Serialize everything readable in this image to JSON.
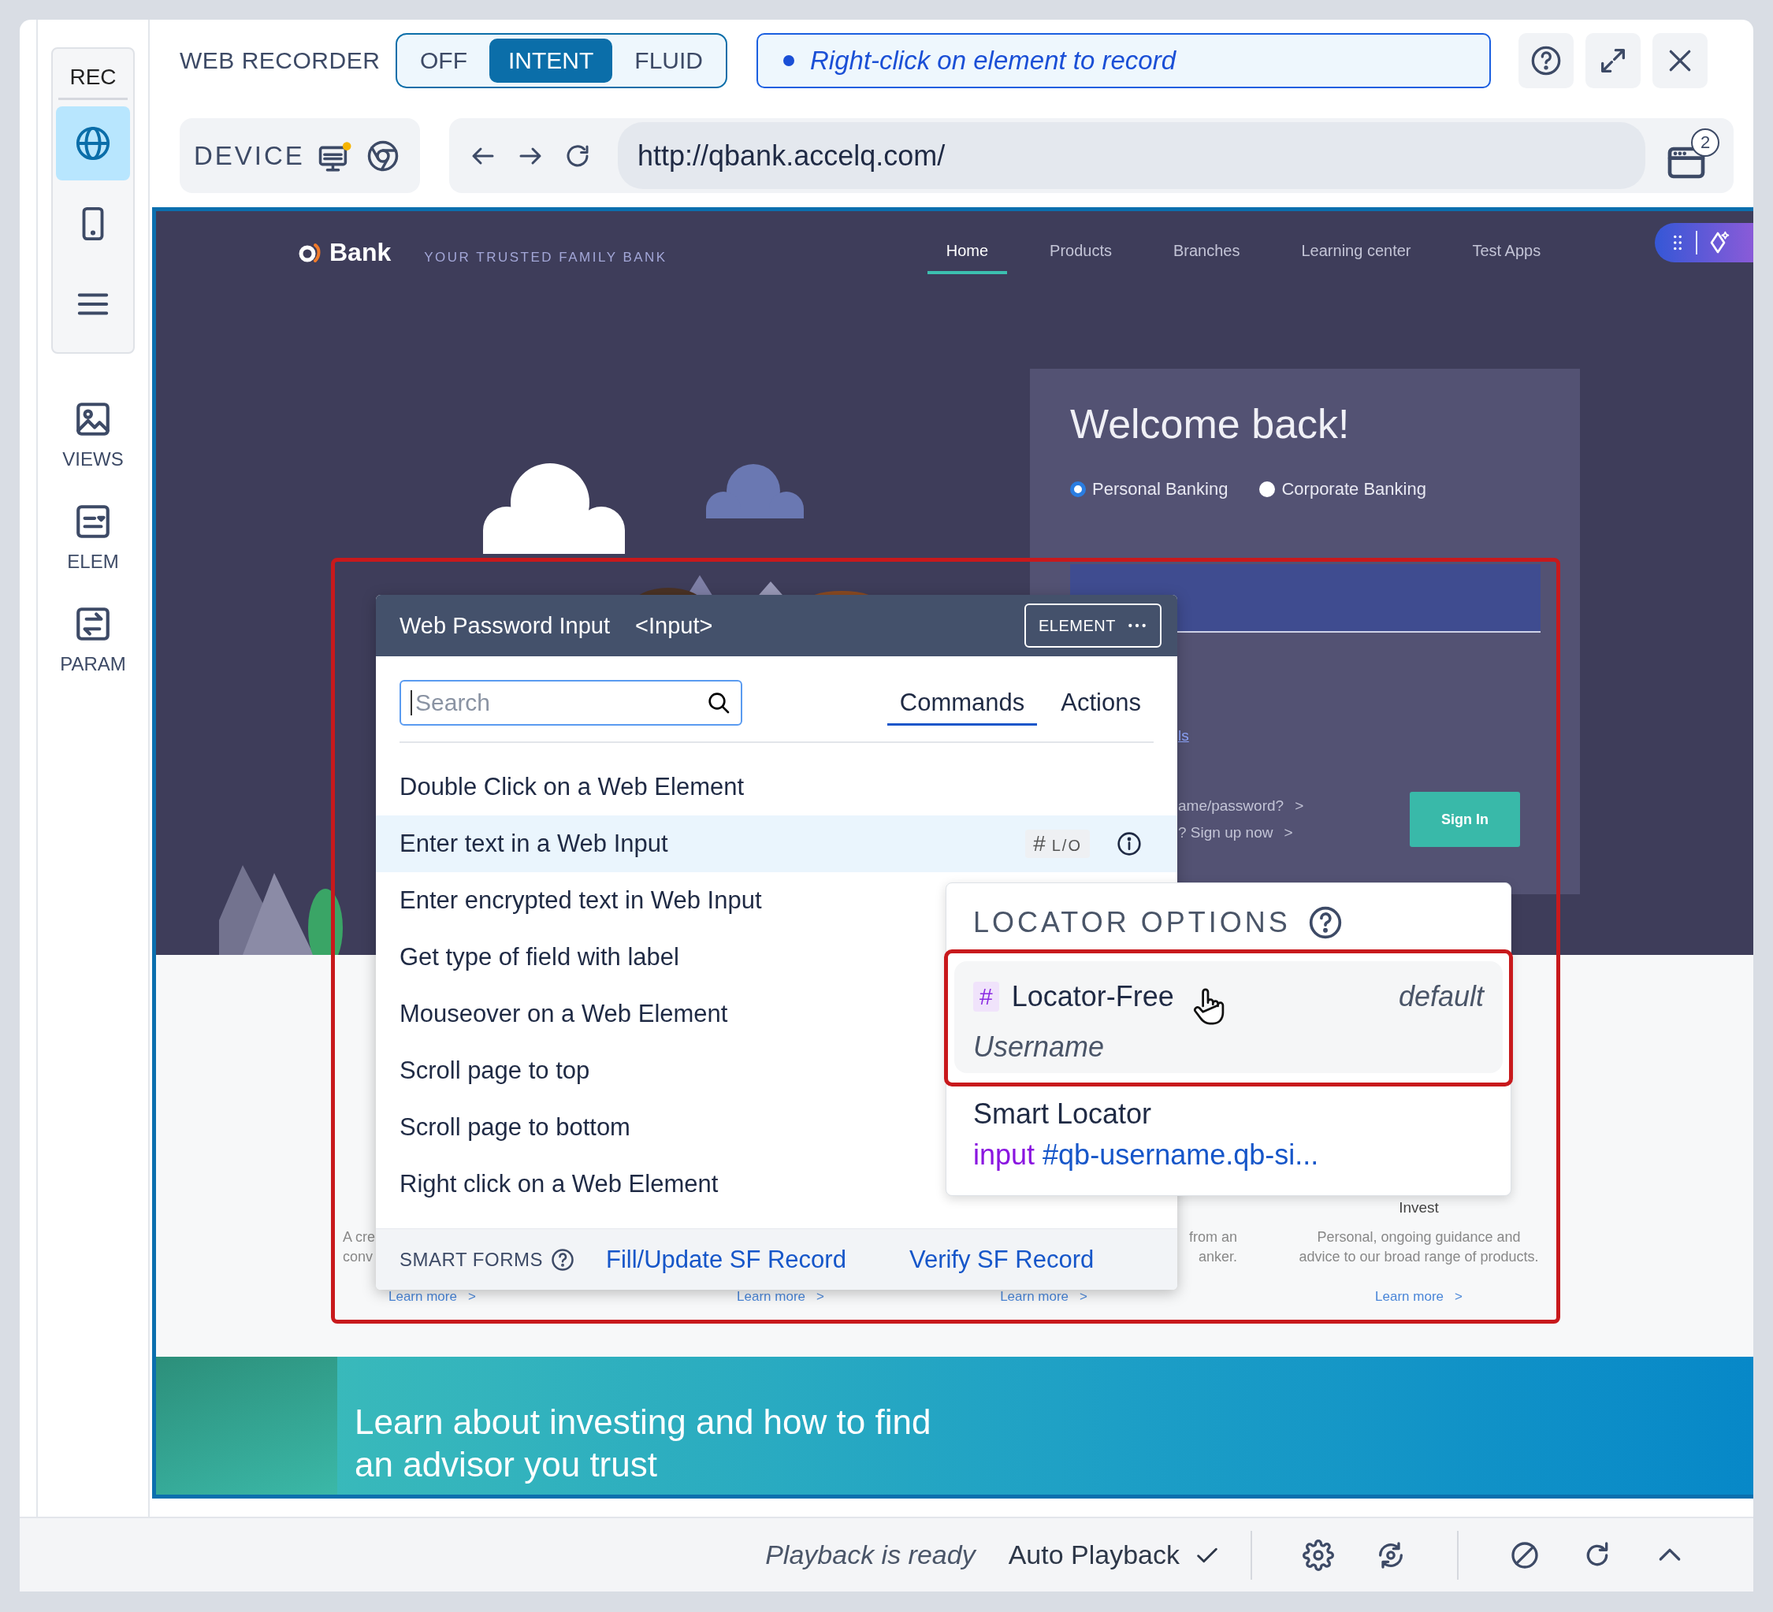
{
  "toolbar": {
    "title": "WEB RECORDER",
    "modes": [
      {
        "label": "OFF",
        "selected": false
      },
      {
        "label": "INTENT",
        "selected": true
      },
      {
        "label": "FLUID",
        "selected": false
      }
    ],
    "hint": "Right-click on element to record"
  },
  "rail": {
    "title": "REC",
    "modes": [
      {
        "selected": true
      },
      {
        "selected": false
      },
      {
        "selected": false
      }
    ],
    "tools": [
      {
        "label": "VIEWS"
      },
      {
        "label": "ELEM"
      },
      {
        "label": "PARAM"
      }
    ]
  },
  "device": {
    "label": "DEVICE"
  },
  "address_bar": {
    "url": "http://qbank.accelq.com/",
    "tab_count": "2"
  },
  "web_page": {
    "logo": "Bank",
    "tagline": "YOUR TRUSTED FAMILY BANK",
    "nav": [
      {
        "label": "Home",
        "selected": true
      },
      {
        "label": "Products",
        "selected": false
      },
      {
        "label": "Branches",
        "selected": false
      },
      {
        "label": "Learning center",
        "selected": false
      },
      {
        "label": "Test Apps",
        "selected": false
      }
    ],
    "login": {
      "title": "Welcome back!",
      "account_types": [
        {
          "label": "Personal Banking",
          "selected": true
        },
        {
          "label": "Corporate Banking",
          "selected": false
        }
      ],
      "link_fragment": "ls",
      "links": [
        {
          "text": "ame/password?",
          "chevron": ">"
        },
        {
          "text": "? Sign up now",
          "chevron": ">"
        }
      ],
      "sign_in": "Sign In"
    },
    "features": [
      {
        "text_lines": [
          "A cre",
          "conv"
        ],
        "link": "Learn more",
        "chevron": ">"
      },
      {
        "link": "Learn more",
        "chevron": ">"
      },
      {
        "text_lines": [
          "from an",
          "anker."
        ],
        "link": "Learn more",
        "chevron": ">"
      },
      {
        "heading": "Invest",
        "text_lines": [
          "Personal, ongoing guidance and",
          "advice to our broad range of products."
        ],
        "link": "Learn more",
        "chevron": ">"
      }
    ],
    "banner": [
      "Learn about investing and how to find",
      "an advisor you trust"
    ]
  },
  "command_panel": {
    "title": "Web Password Input",
    "tag": "<Input>",
    "element_button": "ELEMENT",
    "search": {
      "placeholder": "Search"
    },
    "tabs": [
      {
        "label": "Commands",
        "selected": true
      },
      {
        "label": "Actions",
        "selected": false
      }
    ],
    "commands": [
      {
        "label": "Double Click on a Web Element",
        "selected": false
      },
      {
        "label": "Enter text in a Web Input",
        "selected": true,
        "badge_symbol": "#",
        "badge": "L/O"
      },
      {
        "label": "Enter encrypted text in Web Input",
        "selected": false
      },
      {
        "label": "Get type of field with label",
        "selected": false
      },
      {
        "label": "Mouseover on a Web Element",
        "selected": false
      },
      {
        "label": "Scroll page to top",
        "selected": false
      },
      {
        "label": "Scroll page to bottom",
        "selected": false
      },
      {
        "label": "Right click on a Web Element",
        "selected": false
      }
    ],
    "footer": {
      "label": "SMART FORMS",
      "links": [
        "Fill/Update SF Record",
        "Verify SF Record"
      ]
    }
  },
  "locator_options": {
    "title": "LOCATOR OPTIONS",
    "options": [
      {
        "kind": "locator_free",
        "selected": true,
        "symbol": "#",
        "name": "Locator-Free",
        "tag": "default",
        "value": "Username"
      },
      {
        "kind": "smart",
        "selected": false,
        "name": "Smart Locator",
        "value_prefix": "input",
        "value": "#qb-username.qb-si..."
      }
    ]
  },
  "status_bar": {
    "status": "Playback is ready",
    "auto_playback": {
      "label": "Auto Playback",
      "checked": true
    }
  }
}
